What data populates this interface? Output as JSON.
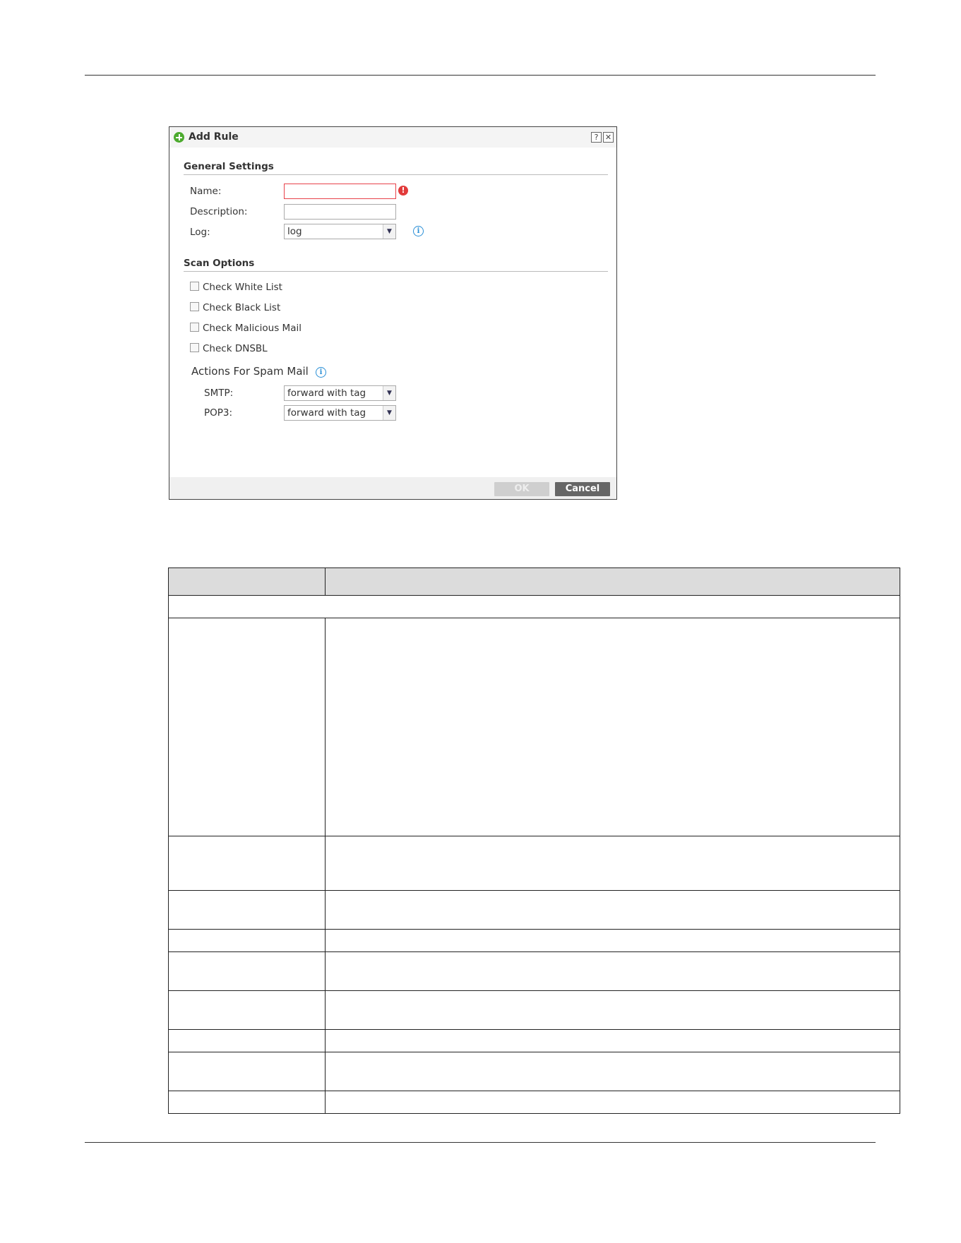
{
  "dialog": {
    "title": "Add Rule",
    "help_label": "?",
    "close_label": "✕",
    "general_settings": {
      "title": "General Settings",
      "name_label": "Name:",
      "name_value": "",
      "description_label": "Description:",
      "description_value": "",
      "log_label": "Log:",
      "log_value": "log"
    },
    "scan_options": {
      "title": "Scan Options",
      "checks": [
        {
          "label": "Check White List",
          "checked": false
        },
        {
          "label": "Check Black List",
          "checked": false
        },
        {
          "label": "Check Malicious Mail",
          "checked": false
        },
        {
          "label": "Check DNSBL",
          "checked": false
        }
      ],
      "actions_title": "Actions For Spam Mail",
      "smtp_label": "SMTP:",
      "smtp_value": "forward with tag",
      "pop3_label": "POP3:",
      "pop3_value": "forward with tag"
    },
    "ok_label": "OK",
    "cancel_label": "Cancel"
  },
  "colors": {
    "accent_green": "#4caa2e",
    "error_red": "#e23b3b",
    "info_blue": "#2a8fd6"
  },
  "icons": [
    "add-icon",
    "help-icon",
    "close-icon",
    "error-icon",
    "info-icon",
    "chevron-down-icon"
  ]
}
